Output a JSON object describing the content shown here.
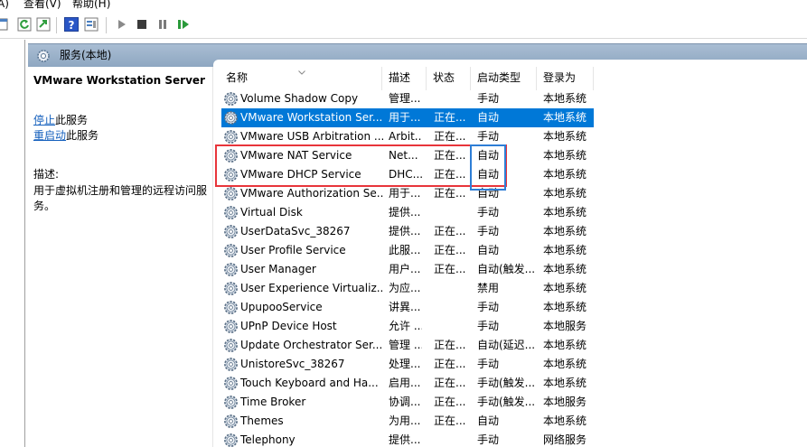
{
  "menu": {
    "action": "A)",
    "view": "查看(V)",
    "help": "帮助(H)"
  },
  "toolbar": {
    "buttons": [
      "back-icon",
      "refresh-icon",
      "export-icon",
      "help-icon",
      "properties-icon",
      "start-icon",
      "stop-icon",
      "pause-icon",
      "restart-icon"
    ]
  },
  "pane": {
    "title": "服务(本地)"
  },
  "detail": {
    "service_name": "VMware Workstation Server",
    "stop_link": "停止",
    "stop_suffix": "此服务",
    "restart_link": "重启动",
    "restart_suffix": "此服务",
    "description_label": "描述:",
    "description": "用于虚拟机注册和管理的远程访问服务。"
  },
  "columns": {
    "name": "名称",
    "description": "描述",
    "status": "状态",
    "startup_type": "启动类型",
    "logon_as": "登录为"
  },
  "services": [
    {
      "name": "Volume Shadow Copy",
      "description": "管理...",
      "status": "",
      "startup": "手动",
      "logon": "本地系统"
    },
    {
      "name": "VMware Workstation Ser...",
      "description": "用于...",
      "status": "正在...",
      "startup": "自动",
      "logon": "本地系统",
      "selected": true
    },
    {
      "name": "VMware USB Arbitration ...",
      "description": "Arbit...",
      "status": "正在...",
      "startup": "手动",
      "logon": "本地系统"
    },
    {
      "name": "VMware NAT Service",
      "description": "Net...",
      "status": "正在...",
      "startup": "自动",
      "logon": "本地系统"
    },
    {
      "name": "VMware DHCP Service",
      "description": "DHC...",
      "status": "正在...",
      "startup": "自动",
      "logon": "本地系统"
    },
    {
      "name": "VMware Authorization Se...",
      "description": "用于...",
      "status": "正在...",
      "startup": "自动",
      "logon": "本地系统"
    },
    {
      "name": "Virtual Disk",
      "description": "提供...",
      "status": "",
      "startup": "手动",
      "logon": "本地系统"
    },
    {
      "name": "UserDataSvc_38267",
      "description": "提供...",
      "status": "正在...",
      "startup": "手动",
      "logon": "本地系统"
    },
    {
      "name": "User Profile Service",
      "description": "此服...",
      "status": "正在...",
      "startup": "自动",
      "logon": "本地系统"
    },
    {
      "name": "User Manager",
      "description": "用户...",
      "status": "正在...",
      "startup": "自动(触发...",
      "logon": "本地系统"
    },
    {
      "name": "User Experience Virtualiz...",
      "description": "为应...",
      "status": "",
      "startup": "禁用",
      "logon": "本地系统"
    },
    {
      "name": "UpupooService",
      "description": "讲異...",
      "status": "",
      "startup": "手动",
      "logon": "本地系统"
    },
    {
      "name": "UPnP Device Host",
      "description": "允许 ...",
      "status": "",
      "startup": "手动",
      "logon": "本地服务"
    },
    {
      "name": "Update Orchestrator Ser...",
      "description": "管理 ...",
      "status": "正在...",
      "startup": "自动(延迟...",
      "logon": "本地系统"
    },
    {
      "name": "UnistoreSvc_38267",
      "description": "处理...",
      "status": "正在...",
      "startup": "手动",
      "logon": "本地系统"
    },
    {
      "name": "Touch Keyboard and Ha...",
      "description": "启用...",
      "status": "正在...",
      "startup": "手动(触发...",
      "logon": "本地系统"
    },
    {
      "name": "Time Broker",
      "description": "协调...",
      "status": "正在...",
      "startup": "手动(触发...",
      "logon": "本地服务"
    },
    {
      "name": "Themes",
      "description": "为用...",
      "status": "正在...",
      "startup": "自动",
      "logon": "本地系统"
    },
    {
      "name": "Telephony",
      "description": "提供...",
      "status": "",
      "startup": "手动",
      "logon": "网络服务"
    }
  ],
  "colors": {
    "selection": "#0078d7",
    "annotation_red": "#e8353b",
    "annotation_blue": "#2e7ed6",
    "link": "#1560bd"
  }
}
